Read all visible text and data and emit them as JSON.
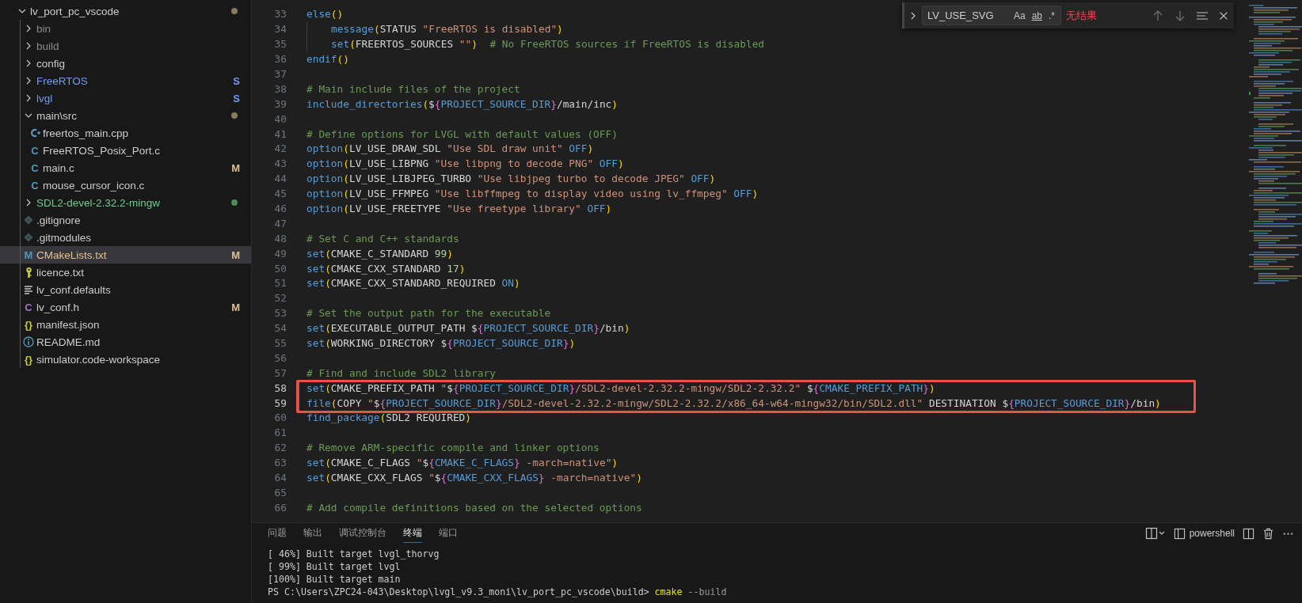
{
  "explorer": {
    "items": [
      {
        "label": "lv_port_pc_vscode",
        "kind": "folder",
        "expanded": true,
        "selected": false,
        "color": "#cccccc",
        "decoration": {
          "kind": "dot",
          "color": "#8a7b63"
        },
        "children": [
          {
            "label": "bin",
            "kind": "folder",
            "expanded": false,
            "selected": false,
            "color": "#8c8c8c"
          },
          {
            "label": "build",
            "kind": "folder",
            "expanded": false,
            "selected": false,
            "color": "#8c8c8c"
          },
          {
            "label": "config",
            "kind": "folder",
            "expanded": false,
            "selected": false,
            "color": "#cccccc"
          },
          {
            "label": "FreeRTOS",
            "kind": "folder",
            "expanded": false,
            "selected": false,
            "color": "#6c9ef8",
            "decoration": {
              "kind": "letter",
              "text": "S",
              "color": "#6c9ef8"
            }
          },
          {
            "label": "lvgl",
            "kind": "folder",
            "expanded": false,
            "selected": false,
            "color": "#6c9ef8",
            "decoration": {
              "kind": "letter",
              "text": "S",
              "color": "#6c9ef8"
            }
          },
          {
            "label": "main\\src",
            "kind": "folder",
            "expanded": true,
            "selected": false,
            "color": "#cccccc",
            "decoration": {
              "kind": "dot",
              "color": "#8a7b63"
            },
            "children": [
              {
                "label": "freertos_main.cpp",
                "kind": "file",
                "selected": false,
                "color": "#cccccc",
                "icon": {
                  "kind": "cpp"
                }
              },
              {
                "label": "FreeRTOS_Posix_Port.c",
                "kind": "file",
                "selected": false,
                "color": "#cccccc",
                "icon": {
                  "kind": "glyph",
                  "text": "C",
                  "color": "#519aba"
                }
              },
              {
                "label": "main.c",
                "kind": "file",
                "selected": false,
                "color": "#cccccc",
                "icon": {
                  "kind": "glyph",
                  "text": "C",
                  "color": "#519aba"
                },
                "decoration": {
                  "kind": "letter",
                  "text": "M",
                  "color": "#e2c08d"
                }
              },
              {
                "label": "mouse_cursor_icon.c",
                "kind": "file",
                "selected": false,
                "color": "#cccccc",
                "icon": {
                  "kind": "glyph",
                  "text": "C",
                  "color": "#519aba"
                }
              }
            ]
          },
          {
            "label": "SDL2-devel-2.32.2-mingw",
            "kind": "folder",
            "expanded": false,
            "selected": false,
            "color": "#73c991",
            "decoration": {
              "kind": "dot",
              "color": "#4d8a55"
            }
          },
          {
            "label": ".gitignore",
            "kind": "file",
            "selected": false,
            "color": "#cccccc",
            "icon": {
              "kind": "git"
            }
          },
          {
            "label": ".gitmodules",
            "kind": "file",
            "selected": false,
            "color": "#cccccc",
            "icon": {
              "kind": "git"
            }
          },
          {
            "label": "CMakeLists.txt",
            "kind": "file",
            "selected": true,
            "color": "#e2c08d",
            "icon": {
              "kind": "glyph",
              "text": "M",
              "color": "#519aba"
            },
            "decoration": {
              "kind": "letter",
              "text": "M",
              "color": "#e2c08d"
            }
          },
          {
            "label": "licence.txt",
            "kind": "file",
            "selected": false,
            "color": "#cccccc",
            "icon": {
              "kind": "licence"
            }
          },
          {
            "label": "lv_conf.defaults",
            "kind": "file",
            "selected": false,
            "color": "#cccccc",
            "icon": {
              "kind": "lines"
            }
          },
          {
            "label": "lv_conf.h",
            "kind": "file",
            "selected": false,
            "color": "#cccccc",
            "icon": {
              "kind": "glyph",
              "text": "C",
              "color": "#a074c4"
            },
            "decoration": {
              "kind": "letter",
              "text": "M",
              "color": "#e2c08d"
            }
          },
          {
            "label": "manifest.json",
            "kind": "file",
            "selected": false,
            "color": "#cccccc",
            "icon": {
              "kind": "glyph",
              "text": "{}",
              "color": "#cbcb41"
            }
          },
          {
            "label": "README.md",
            "kind": "file",
            "selected": false,
            "color": "#cccccc",
            "icon": {
              "kind": "info"
            }
          },
          {
            "label": "simulator.code-workspace",
            "kind": "file",
            "selected": false,
            "color": "#cccccc",
            "icon": {
              "kind": "glyph",
              "text": "{}",
              "color": "#cbcb41"
            }
          }
        ]
      }
    ]
  },
  "find": {
    "query": "LV_USE_SVG",
    "options": [
      {
        "label": "Aa",
        "on": false
      },
      {
        "label": "ab",
        "on": false
      },
      {
        "label": ".*",
        "on": false
      }
    ],
    "result": "无结果"
  },
  "code": {
    "lines": [
      {
        "number": "33",
        "modified": false,
        "boxed": false,
        "indented": false,
        "tokens": [
          {
            "kind": "fn",
            "text": "else"
          },
          {
            "kind": "p",
            "text": "()"
          }
        ]
      },
      {
        "number": "34",
        "modified": false,
        "boxed": false,
        "indented": true,
        "tokens": [
          {
            "kind": "fn",
            "text": "message"
          },
          {
            "kind": "p",
            "text": "("
          },
          {
            "kind": "v",
            "text": "STATUS "
          },
          {
            "kind": "s",
            "text": "\"FreeRTOS is disabled\""
          },
          {
            "kind": "p",
            "text": ")"
          }
        ]
      },
      {
        "number": "35",
        "modified": false,
        "boxed": false,
        "indented": true,
        "tokens": [
          {
            "kind": "fn",
            "text": "set"
          },
          {
            "kind": "p",
            "text": "("
          },
          {
            "kind": "v",
            "text": "FREERTOS_SOURCES "
          },
          {
            "kind": "s",
            "text": "\"\""
          },
          {
            "kind": "p",
            "text": ")"
          },
          {
            "kind": "c",
            "text": "  # No FreeRTOS sources if FreeRTOS is disabled"
          }
        ]
      },
      {
        "number": "36",
        "modified": false,
        "boxed": false,
        "indented": false,
        "tokens": [
          {
            "kind": "fn",
            "text": "endif"
          },
          {
            "kind": "p",
            "text": "()"
          }
        ]
      },
      {
        "number": "37",
        "modified": false,
        "boxed": false,
        "indented": false
      },
      {
        "number": "38",
        "modified": false,
        "boxed": false,
        "indented": false,
        "tokens": [
          {
            "kind": "c",
            "text": "# Main include files of the project"
          }
        ]
      },
      {
        "number": "39",
        "modified": false,
        "boxed": false,
        "indented": false,
        "tokens": [
          {
            "kind": "fn",
            "text": "include_directories"
          },
          {
            "kind": "p",
            "text": "("
          },
          {
            "kind": "d",
            "text": "$"
          },
          {
            "kind": "b",
            "text": "{"
          },
          {
            "kind": "r",
            "text": "PROJECT_SOURCE_DIR"
          },
          {
            "kind": "b",
            "text": "}"
          },
          {
            "kind": "t",
            "text": "/main/inc"
          },
          {
            "kind": "p",
            "text": ")"
          }
        ]
      },
      {
        "number": "40",
        "modified": false,
        "boxed": false,
        "indented": false
      },
      {
        "number": "41",
        "modified": false,
        "boxed": false,
        "indented": false,
        "tokens": [
          {
            "kind": "c",
            "text": "# Define options for LVGL with default values (OFF)"
          }
        ]
      },
      {
        "number": "42",
        "modified": false,
        "boxed": false,
        "indented": false,
        "tokens": [
          {
            "kind": "fn",
            "text": "option"
          },
          {
            "kind": "p",
            "text": "("
          },
          {
            "kind": "v",
            "text": "LV_USE_DRAW_SDL "
          },
          {
            "kind": "s",
            "text": "\"Use SDL draw unit\""
          },
          {
            "kind": "k",
            "text": " OFF"
          },
          {
            "kind": "p",
            "text": ")"
          }
        ]
      },
      {
        "number": "43",
        "modified": false,
        "boxed": false,
        "indented": false,
        "tokens": [
          {
            "kind": "fn",
            "text": "option"
          },
          {
            "kind": "p",
            "text": "("
          },
          {
            "kind": "v",
            "text": "LV_USE_LIBPNG "
          },
          {
            "kind": "s",
            "text": "\"Use libpng to decode PNG\""
          },
          {
            "kind": "k",
            "text": " OFF"
          },
          {
            "kind": "p",
            "text": ")"
          }
        ]
      },
      {
        "number": "44",
        "modified": false,
        "boxed": false,
        "indented": false,
        "tokens": [
          {
            "kind": "fn",
            "text": "option"
          },
          {
            "kind": "p",
            "text": "("
          },
          {
            "kind": "v",
            "text": "LV_USE_LIBJPEG_TURBO "
          },
          {
            "kind": "s",
            "text": "\"Use libjpeg turbo to decode JPEG\""
          },
          {
            "kind": "k",
            "text": " OFF"
          },
          {
            "kind": "p",
            "text": ")"
          }
        ]
      },
      {
        "number": "45",
        "modified": false,
        "boxed": false,
        "indented": false,
        "tokens": [
          {
            "kind": "fn",
            "text": "option"
          },
          {
            "kind": "p",
            "text": "("
          },
          {
            "kind": "v",
            "text": "LV_USE_FFMPEG "
          },
          {
            "kind": "s",
            "text": "\"Use libffmpeg to display video using lv_ffmpeg\""
          },
          {
            "kind": "k",
            "text": " OFF"
          },
          {
            "kind": "p",
            "text": ")"
          }
        ]
      },
      {
        "number": "46",
        "modified": false,
        "boxed": false,
        "indented": false,
        "tokens": [
          {
            "kind": "fn",
            "text": "option"
          },
          {
            "kind": "p",
            "text": "("
          },
          {
            "kind": "v",
            "text": "LV_USE_FREETYPE "
          },
          {
            "kind": "s",
            "text": "\"Use freetype library\""
          },
          {
            "kind": "k",
            "text": " OFF"
          },
          {
            "kind": "p",
            "text": ")"
          }
        ]
      },
      {
        "number": "47",
        "modified": false,
        "boxed": false,
        "indented": false
      },
      {
        "number": "48",
        "modified": false,
        "boxed": false,
        "indented": false,
        "tokens": [
          {
            "kind": "c",
            "text": "# Set C and C++ standards"
          }
        ]
      },
      {
        "number": "49",
        "modified": false,
        "boxed": false,
        "indented": false,
        "tokens": [
          {
            "kind": "fn",
            "text": "set"
          },
          {
            "kind": "p",
            "text": "("
          },
          {
            "kind": "v",
            "text": "CMAKE_C_STANDARD "
          },
          {
            "kind": "n",
            "text": "99"
          },
          {
            "kind": "p",
            "text": ")"
          }
        ]
      },
      {
        "number": "50",
        "modified": false,
        "boxed": false,
        "indented": false,
        "tokens": [
          {
            "kind": "fn",
            "text": "set"
          },
          {
            "kind": "p",
            "text": "("
          },
          {
            "kind": "v",
            "text": "CMAKE_CXX_STANDARD "
          },
          {
            "kind": "n",
            "text": "17"
          },
          {
            "kind": "p",
            "text": ")"
          }
        ]
      },
      {
        "number": "51",
        "modified": false,
        "boxed": false,
        "indented": false,
        "tokens": [
          {
            "kind": "fn",
            "text": "set"
          },
          {
            "kind": "p",
            "text": "("
          },
          {
            "kind": "v",
            "text": "CMAKE_CXX_STANDARD_REQUIRED "
          },
          {
            "kind": "k",
            "text": "ON"
          },
          {
            "kind": "p",
            "text": ")"
          }
        ]
      },
      {
        "number": "52",
        "modified": false,
        "boxed": false,
        "indented": false
      },
      {
        "number": "53",
        "modified": false,
        "boxed": false,
        "indented": false,
        "tokens": [
          {
            "kind": "c",
            "text": "# Set the output path for the executable"
          }
        ]
      },
      {
        "number": "54",
        "modified": false,
        "boxed": false,
        "indented": false,
        "tokens": [
          {
            "kind": "fn",
            "text": "set"
          },
          {
            "kind": "p",
            "text": "("
          },
          {
            "kind": "v",
            "text": "EXECUTABLE_OUTPUT_PATH "
          },
          {
            "kind": "d",
            "text": "$"
          },
          {
            "kind": "b",
            "text": "{"
          },
          {
            "kind": "r",
            "text": "PROJECT_SOURCE_DIR"
          },
          {
            "kind": "b",
            "text": "}"
          },
          {
            "kind": "t",
            "text": "/bin"
          },
          {
            "kind": "p",
            "text": ")"
          }
        ]
      },
      {
        "number": "55",
        "modified": false,
        "boxed": false,
        "indented": false,
        "tokens": [
          {
            "kind": "fn",
            "text": "set"
          },
          {
            "kind": "p",
            "text": "("
          },
          {
            "kind": "v",
            "text": "WORKING_DIRECTORY "
          },
          {
            "kind": "d",
            "text": "$"
          },
          {
            "kind": "b",
            "text": "{"
          },
          {
            "kind": "r",
            "text": "PROJECT_SOURCE_DIR"
          },
          {
            "kind": "b",
            "text": "}"
          },
          {
            "kind": "p",
            "text": ")"
          }
        ]
      },
      {
        "number": "56",
        "modified": false,
        "boxed": false,
        "indented": false
      },
      {
        "number": "57",
        "modified": false,
        "boxed": false,
        "indented": false,
        "tokens": [
          {
            "kind": "c",
            "text": "# Find and include SDL2 library"
          }
        ]
      },
      {
        "number": "58",
        "modified": true,
        "boxed": true,
        "indented": false,
        "tokens": [
          {
            "kind": "fn",
            "text": "set"
          },
          {
            "kind": "p",
            "text": "("
          },
          {
            "kind": "v",
            "text": "CMAKE_PREFIX_PATH "
          },
          {
            "kind": "s",
            "text": "\""
          },
          {
            "kind": "d",
            "text": "$"
          },
          {
            "kind": "b",
            "text": "{"
          },
          {
            "kind": "r",
            "text": "PROJECT_SOURCE_DIR"
          },
          {
            "kind": "b",
            "text": "}"
          },
          {
            "kind": "s",
            "text": "/SDL2-devel-2.32.2-mingw/SDL2-2.32.2\" "
          },
          {
            "kind": "d",
            "text": "$"
          },
          {
            "kind": "b",
            "text": "{"
          },
          {
            "kind": "r",
            "text": "CMAKE_PREFIX_PATH"
          },
          {
            "kind": "b",
            "text": "}"
          },
          {
            "kind": "p",
            "text": ")"
          }
        ]
      },
      {
        "number": "59",
        "modified": true,
        "boxed": true,
        "indented": false,
        "tokens": [
          {
            "kind": "fn",
            "text": "file"
          },
          {
            "kind": "p",
            "text": "("
          },
          {
            "kind": "v",
            "text": "COPY "
          },
          {
            "kind": "s",
            "text": "\""
          },
          {
            "kind": "d",
            "text": "$"
          },
          {
            "kind": "b",
            "text": "{"
          },
          {
            "kind": "r",
            "text": "PROJECT_SOURCE_DIR"
          },
          {
            "kind": "b",
            "text": "}"
          },
          {
            "kind": "s",
            "text": "/SDL2-devel-2.32.2-mingw/SDL2-2.32.2/x86_64-w64-mingw32/bin/SDL2.dll\""
          },
          {
            "kind": "v",
            "text": " DESTINATION "
          },
          {
            "kind": "d",
            "text": "$"
          },
          {
            "kind": "b",
            "text": "{"
          },
          {
            "kind": "r",
            "text": "PROJECT_SOURCE_DIR"
          },
          {
            "kind": "b",
            "text": "}"
          },
          {
            "kind": "t",
            "text": "/bin"
          },
          {
            "kind": "p",
            "text": ")"
          }
        ]
      },
      {
        "number": "60",
        "modified": false,
        "boxed": false,
        "indented": false,
        "tokens": [
          {
            "kind": "fn",
            "text": "find_package"
          },
          {
            "kind": "p",
            "text": "("
          },
          {
            "kind": "v",
            "text": "SDL2 REQUIRED"
          },
          {
            "kind": "p",
            "text": ")"
          }
        ]
      },
      {
        "number": "61",
        "modified": false,
        "boxed": false,
        "indented": false
      },
      {
        "number": "62",
        "modified": false,
        "boxed": false,
        "indented": false,
        "tokens": [
          {
            "kind": "c",
            "text": "# Remove ARM-specific compile and linker options"
          }
        ]
      },
      {
        "number": "63",
        "modified": false,
        "boxed": false,
        "indented": false,
        "tokens": [
          {
            "kind": "fn",
            "text": "set"
          },
          {
            "kind": "p",
            "text": "("
          },
          {
            "kind": "v",
            "text": "CMAKE_C_FLAGS "
          },
          {
            "kind": "s",
            "text": "\""
          },
          {
            "kind": "d",
            "text": "$"
          },
          {
            "kind": "b",
            "text": "{"
          },
          {
            "kind": "r",
            "text": "CMAKE_C_FLAGS"
          },
          {
            "kind": "b",
            "text": "}"
          },
          {
            "kind": "s",
            "text": " -march=native\""
          },
          {
            "kind": "p",
            "text": ")"
          }
        ]
      },
      {
        "number": "64",
        "modified": false,
        "boxed": false,
        "indented": false,
        "tokens": [
          {
            "kind": "fn",
            "text": "set"
          },
          {
            "kind": "p",
            "text": "("
          },
          {
            "kind": "v",
            "text": "CMAKE_CXX_FLAGS "
          },
          {
            "kind": "s",
            "text": "\""
          },
          {
            "kind": "d",
            "text": "$"
          },
          {
            "kind": "b",
            "text": "{"
          },
          {
            "kind": "r",
            "text": "CMAKE_CXX_FLAGS"
          },
          {
            "kind": "b",
            "text": "}"
          },
          {
            "kind": "s",
            "text": " -march=native\""
          },
          {
            "kind": "p",
            "text": ")"
          }
        ]
      },
      {
        "number": "65",
        "modified": false,
        "boxed": false,
        "indented": false
      },
      {
        "number": "66",
        "modified": false,
        "boxed": false,
        "indented": false,
        "tokens": [
          {
            "kind": "c",
            "text": "# Add compile definitions based on the selected options"
          }
        ]
      }
    ]
  },
  "panel": {
    "tabs": [
      {
        "label": "问题",
        "selected": false
      },
      {
        "label": "输出",
        "selected": false
      },
      {
        "label": "调试控制台",
        "selected": false
      },
      {
        "label": "终端",
        "selected": true
      },
      {
        "label": "端口",
        "selected": false
      }
    ],
    "shell": "powershell",
    "terminal_lines": [
      [
        {
          "kind": "plain",
          "text": "[ 46%] Built target lvgl_thorvg"
        }
      ],
      [
        {
          "kind": "plain",
          "text": "[ 99%] Built target lvgl"
        }
      ],
      [
        {
          "kind": "plain",
          "text": "[100%] Built target main"
        }
      ],
      [
        {
          "kind": "plain",
          "text": "PS C:\\Users\\ZPC24-043\\Desktop\\lvgl_v9.3_moni\\lv_port_pc_vscode\\build> "
        },
        {
          "kind": "command",
          "text": "cmake"
        },
        {
          "kind": "arg",
          "text": " --build"
        }
      ]
    ]
  }
}
